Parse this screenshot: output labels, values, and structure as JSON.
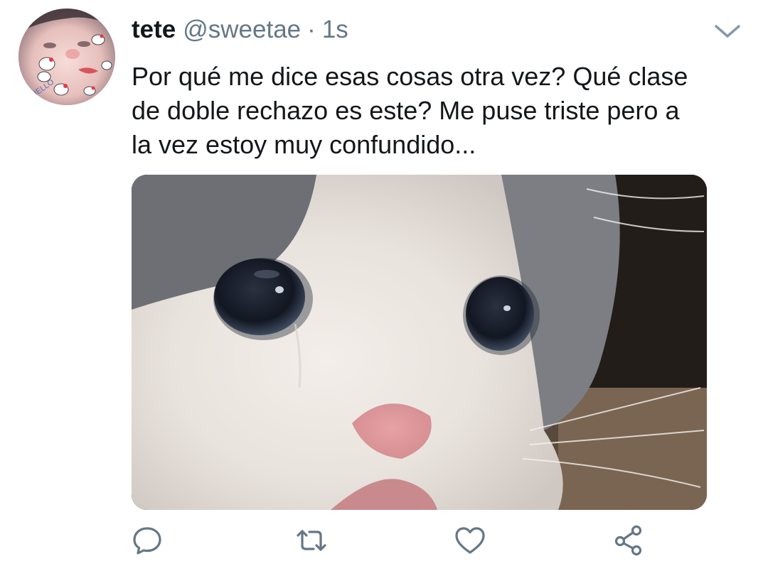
{
  "tweet": {
    "display_name": "tete",
    "handle": "@sweetae",
    "separator": "·",
    "time": "1s",
    "text": "Por qué me dice esas cosas otra vez? Qué clase\nde doble rechazo es este? Me puse triste pero a\nla vez estoy muy confundido...",
    "avatar_sticker_text": "HELLO"
  },
  "icons": {
    "menu": "chevron-down-icon",
    "reply": "reply-bubble-icon",
    "retweet": "retweet-icon",
    "like": "heart-icon",
    "share": "share-icon"
  },
  "colors": {
    "text": "#14171a",
    "secondary": "#657786",
    "icon": "#657786",
    "background": "#ffffff"
  }
}
